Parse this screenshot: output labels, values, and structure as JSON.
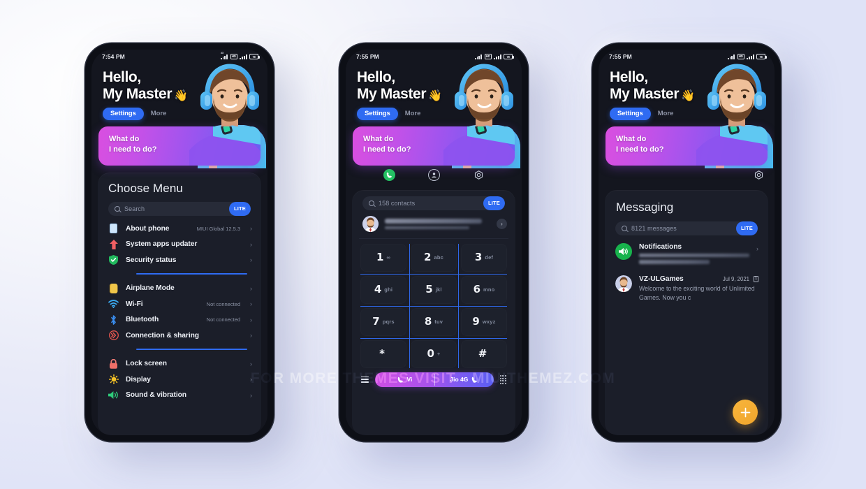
{
  "watermark": "FOR MORE THEMES VISIT - MIUITHEMEZ.COM",
  "colors": {
    "accent_blue": "#2f6bf2",
    "banner_start": "#d94fe0",
    "banner_end": "#6a5ef2",
    "fab_orange": "#f0a52c",
    "active_green": "#24c063"
  },
  "hero": {
    "greeting_line1": "Hello,",
    "greeting_line2": "My Master",
    "wave_emoji": "👋",
    "tab_active": "Settings",
    "tab_other": "More",
    "banner_line1": "What do",
    "banner_line2": "I need to do?"
  },
  "phones": [
    {
      "status": {
        "time": "7:54 PM",
        "battery": "78"
      },
      "screen": "settings",
      "card_title": "Choose Menu",
      "search": {
        "placeholder": "Search",
        "badge": "LITE"
      },
      "groups": [
        {
          "items": [
            {
              "icon": "phone-info-icon",
              "label": "About phone",
              "value": "MIUI Global 12.5.3",
              "chevron": "›"
            },
            {
              "icon": "up-arrow-icon",
              "label": "System apps updater",
              "value": "",
              "chevron": "›"
            },
            {
              "icon": "shield-check-icon",
              "label": "Security status",
              "value": "",
              "chevron": "›"
            }
          ]
        },
        {
          "items": [
            {
              "icon": "airplane-icon",
              "label": "Airplane Mode",
              "value": "",
              "chevron": "›"
            },
            {
              "icon": "wifi-icon",
              "label": "Wi-Fi",
              "value": "Not connected",
              "chevron": "›"
            },
            {
              "icon": "bluetooth-icon",
              "label": "Bluetooth",
              "value": "Not connected",
              "chevron": "›"
            },
            {
              "icon": "connection-sharing-icon",
              "label": "Connection & sharing",
              "value": "",
              "chevron": "›"
            }
          ]
        },
        {
          "items": [
            {
              "icon": "lock-icon",
              "label": "Lock screen",
              "value": "",
              "chevron": "›"
            },
            {
              "icon": "brightness-icon",
              "label": "Display",
              "value": "",
              "chevron": "›"
            },
            {
              "icon": "speaker-icon",
              "label": "Sound & vibration",
              "value": "",
              "chevron": "›"
            }
          ]
        }
      ]
    },
    {
      "status": {
        "time": "7:55 PM",
        "battery": "78"
      },
      "screen": "dialer",
      "tabs": [
        {
          "name": "phone-tab",
          "icon": "phone-icon",
          "active": true
        },
        {
          "name": "contacts-tab",
          "icon": "person-icon",
          "active": false
        },
        {
          "name": "settings-tab",
          "icon": "gear-icon",
          "active": false
        }
      ],
      "search": {
        "placeholder": "158 contacts",
        "badge": "LITE"
      },
      "contact": {
        "name_redacted": true,
        "chevron": "›"
      },
      "keypad": [
        {
          "digit": "1",
          "sub": "∞"
        },
        {
          "digit": "2",
          "sub": "abc"
        },
        {
          "digit": "3",
          "sub": "def"
        },
        {
          "digit": "4",
          "sub": "ghi"
        },
        {
          "digit": "5",
          "sub": "jkl"
        },
        {
          "digit": "6",
          "sub": "mno"
        },
        {
          "digit": "7",
          "sub": "pqrs"
        },
        {
          "digit": "8",
          "sub": "tuv"
        },
        {
          "digit": "9",
          "sub": "wxyz"
        },
        {
          "digit": "*",
          "sub": ""
        },
        {
          "digit": "0",
          "sub": "+"
        },
        {
          "digit": "#",
          "sub": ""
        }
      ],
      "dialbar": {
        "menu_icon": "hamburger-icon",
        "sim1_label": "Vi",
        "sim2_label": "Jio 4G",
        "keypad_toggle_icon": "dialpad-icon"
      }
    },
    {
      "status": {
        "time": "7:55 PM",
        "battery": "78"
      },
      "screen": "messaging",
      "settings_icon": "gear-icon",
      "card_title": "Messaging",
      "search": {
        "placeholder": "8121 messages",
        "badge": "LITE"
      },
      "messages": [
        {
          "avatar": "speaker-icon",
          "name": "Notifications",
          "date": "",
          "badge": "",
          "preview": "",
          "redacted": true,
          "chevron": "›"
        },
        {
          "avatar": "person-avatar",
          "name": "VZ-ULGames",
          "date": "Jul 9, 2021",
          "badge": "1",
          "preview": "Welcome to the exciting world of Unlimited Games. Now you c",
          "redacted": false,
          "chevron": ""
        }
      ],
      "fab": {
        "icon": "plus-icon",
        "label": "+"
      }
    }
  ]
}
